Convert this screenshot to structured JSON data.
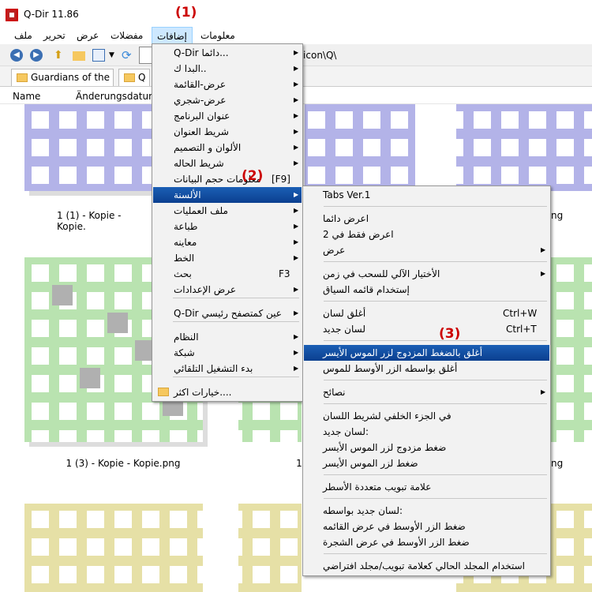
{
  "window": {
    "title": "Q-Dir 11.86"
  },
  "menubar": {
    "items": [
      "ملف",
      "تحرير",
      "عرض",
      "مفضلات",
      "إضافات",
      "معلومات"
    ]
  },
  "address": {
    "path": "\\icon\\Q\\"
  },
  "tabs": [
    "Guardians of the ...",
    "Q"
  ],
  "columns": [
    "Name",
    "Änderungsdatum"
  ],
  "files": [
    "1 (1) - Kopie - Kopie.",
    "ng",
    "1 (3) - Kopie - Kopie.png",
    "1",
    "ng"
  ],
  "menu1": {
    "items": [
      "Q-Dir دائما...",
      "البدا ك..",
      "عرض-القائمة",
      "عرض-شجري",
      "عنوان البرنامج",
      "شريط العنوان",
      "الألوان و التصميم",
      "شريط الحاله",
      "معلومات حجم البيانات",
      "الألسنة",
      "ملف العمليات",
      "طباعة",
      "معاينه",
      "الخط",
      "بحث",
      "عرض الإعدادات",
      "Q-Dir عين كمتصفح رئيسي",
      "النظام",
      "شبكة",
      "بدء التشغيل التلقائي",
      "خيارات اكثر...."
    ],
    "shortcuts": {
      "f9": "[F9]",
      "f3": "F3"
    }
  },
  "menu2": {
    "items": [
      "Tabs Ver.1",
      "اعرض دائما",
      "اعرض فقط في 2",
      "عرض",
      "الأختيار الآلي للسحب في زمن",
      "إستخدام قائمه السياق",
      "أغلق لسان",
      "لسان جديد",
      "أغلق بالضغط المزدوج لزر الموس الأيسر",
      "أغلق بواسطه الزر الأوسط للموس",
      "نصائح",
      "في الجزء الخلفي لشريط اللسان",
      "لسان جديد:",
      "ضغط مزدوج لزر الموس الأيسر",
      "ضغط لزر الموس الأيسر",
      "علامة تبويب متعددة الأسطر",
      "لسان جديد بواسطه:",
      "ضغط الزر الأوسط في عرض القائمه",
      "ضغط الزر الأوسط في عرض الشجرة",
      "استخدام المجلد الحالي كعلامة تبويب/مجلد افتراضي"
    ],
    "shortcuts": {
      "close": "Ctrl+W",
      "new": "Ctrl+T"
    }
  },
  "annotations": [
    "(1)",
    "(2)",
    "(3)"
  ],
  "colors": {
    "highlight": "#0b3f8f",
    "purple": "#b3b3e8",
    "green": "#b9e3b0",
    "yellow": "#e6e0a6",
    "gray": "#b0b0b0"
  }
}
